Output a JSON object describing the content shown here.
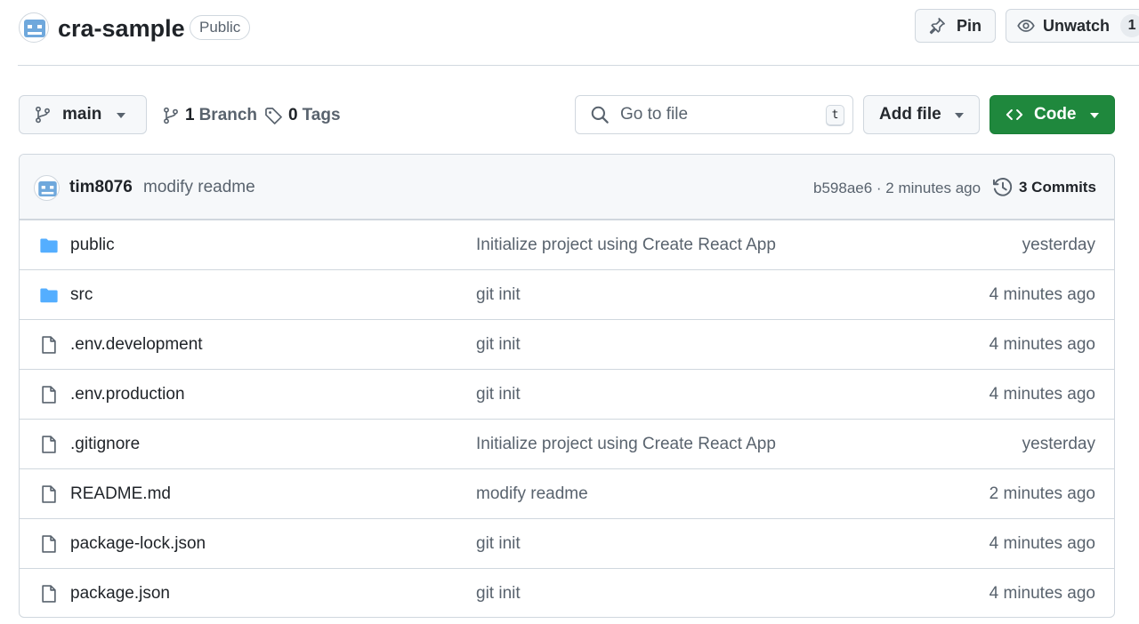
{
  "repo": {
    "name": "cra-sample",
    "visibility": "Public"
  },
  "header_actions": {
    "pin_label": "Pin",
    "unwatch_label": "Unwatch",
    "watch_count": "1"
  },
  "toolbar": {
    "branch": "main",
    "branches_count": "1",
    "branches_word": "Branch",
    "tags_count": "0",
    "tags_word": "Tags",
    "goto_placeholder": "Go to file",
    "goto_shortcut": "t",
    "add_file_label": "Add file",
    "code_label": "Code"
  },
  "latest_commit": {
    "author": "tim8076",
    "message": "modify readme",
    "meta": "b598ae6 · 2 minutes ago",
    "commits_label": "3 Commits"
  },
  "files": [
    {
      "icon": "folder-icon",
      "name": "public",
      "commit": "Initialize project using Create React App",
      "date": "yesterday"
    },
    {
      "icon": "folder-icon",
      "name": "src",
      "commit": "git init",
      "date": "4 minutes ago"
    },
    {
      "icon": "file-icon",
      "name": ".env.development",
      "commit": "git init",
      "date": "4 minutes ago"
    },
    {
      "icon": "file-icon",
      "name": ".env.production",
      "commit": "git init",
      "date": "4 minutes ago"
    },
    {
      "icon": "file-icon",
      "name": ".gitignore",
      "commit": "Initialize project using Create React App",
      "date": "yesterday"
    },
    {
      "icon": "file-icon",
      "name": "README.md",
      "commit": "modify readme",
      "date": "2 minutes ago"
    },
    {
      "icon": "file-icon",
      "name": "package-lock.json",
      "commit": "git init",
      "date": "4 minutes ago"
    },
    {
      "icon": "file-icon",
      "name": "package.json",
      "commit": "git init",
      "date": "4 minutes ago"
    }
  ],
  "colors": {
    "accent_green": "#1f883d",
    "folder_blue": "#54aeff",
    "avatar_blue": "#6fa8dc"
  }
}
